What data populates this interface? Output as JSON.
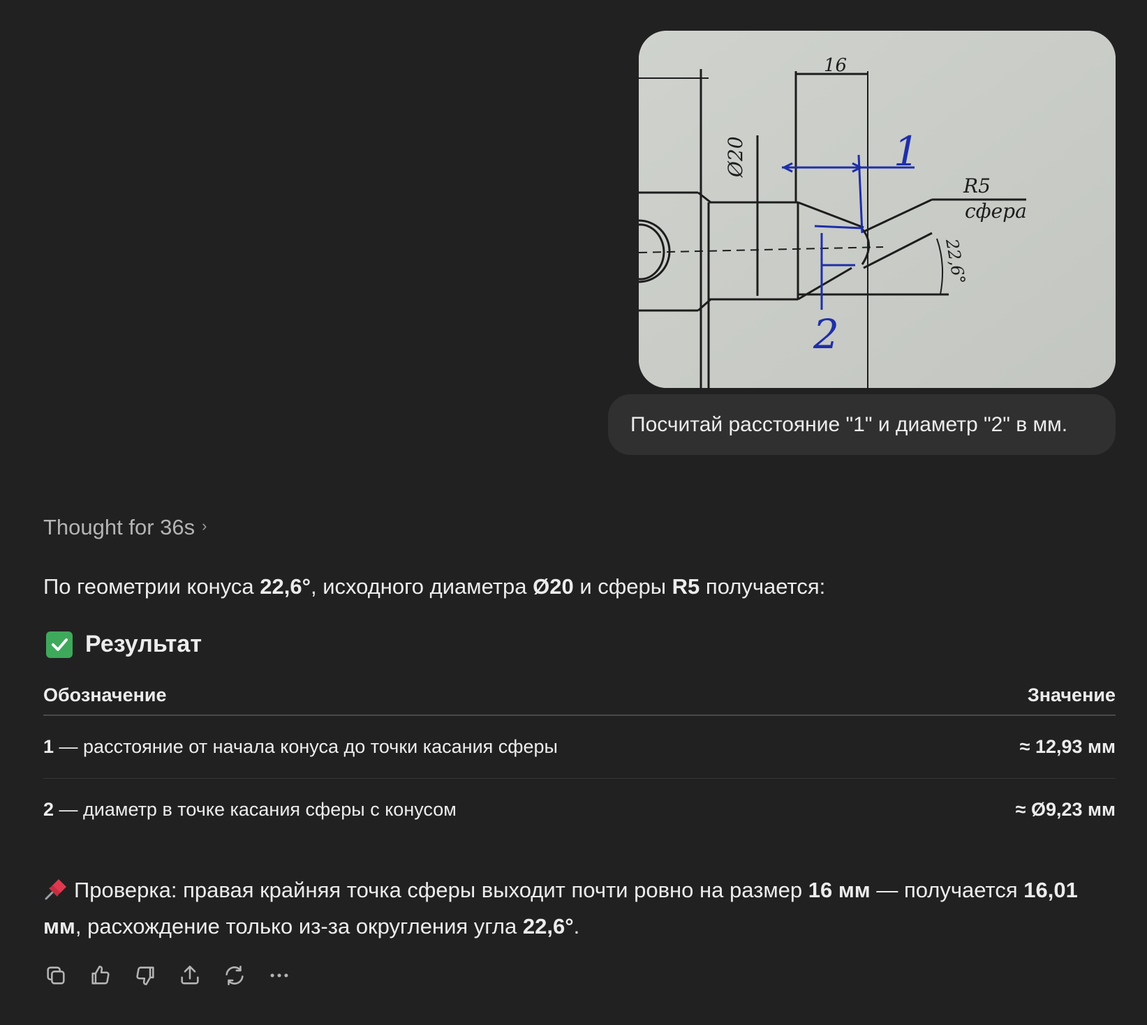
{
  "user": {
    "message": "Посчитай расстояние \"1\" и диаметр \"2\" в мм.",
    "image": {
      "label_16": "16",
      "label_d20": "Ø20",
      "label_1": "1",
      "label_2": "2",
      "label_r5": "R5",
      "label_sphere": "сфера",
      "label_angle": "22,6°"
    }
  },
  "assistant": {
    "thought_label": "Thought for 36s",
    "intro": {
      "t1": "По геометрии конуса ",
      "b1": "22,6°",
      "t2": ", исходного диаметра ",
      "b2": "Ø20",
      "t3": " и сферы ",
      "b3": "R5",
      "t4": " получается:"
    },
    "result_heading": "Результат",
    "table": {
      "headers": [
        "Обозначение",
        "Значение"
      ],
      "rows": [
        {
          "num": "1",
          "desc": " — расстояние от начала конуса до точки касания сферы",
          "value": "≈ 12,93 мм"
        },
        {
          "num": "2",
          "desc": " — диаметр в точке касания сферы с конусом",
          "value": "≈ Ø9,23 мм"
        }
      ]
    },
    "check": {
      "t1": "Проверка: правая крайняя точка сферы выходит почти ровно на размер ",
      "b1": "16 мм",
      "t2": " — получается ",
      "b2": "16,01 мм",
      "t3": ", расхождение только из-за округления угла ",
      "b3": "22,6°",
      "t4": "."
    },
    "actions": [
      "copy-icon",
      "thumbs-up-icon",
      "thumbs-down-icon",
      "share-icon",
      "regenerate-icon",
      "more-icon"
    ]
  },
  "colors": {
    "background": "#212121",
    "bubble": "#303030",
    "text": "#ececec",
    "muted": "#b4b4b4",
    "check_green": "#3ea95b",
    "ink_blue": "#1f2fa8"
  }
}
